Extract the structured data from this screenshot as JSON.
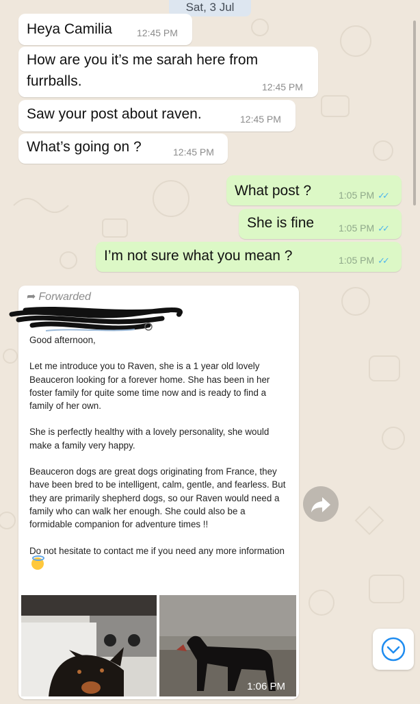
{
  "date_pill": "Sat, 3 Jul",
  "messages": [
    {
      "text": "Heya Camilia",
      "time": "12:45 PM",
      "dir": "in"
    },
    {
      "text": "How are you it’s me sarah here from\nfurrballs.",
      "time": "12:45 PM",
      "dir": "in"
    },
    {
      "text": "Saw your post about raven.",
      "time": "12:45 PM",
      "dir": "in"
    },
    {
      "text": "What’s going on ?",
      "time": "12:45 PM",
      "dir": "in"
    },
    {
      "text": "What post ?",
      "time": "1:05 PM",
      "dir": "out",
      "status": "read"
    },
    {
      "text": "She is fine",
      "time": "1:05 PM",
      "dir": "out",
      "status": "read"
    },
    {
      "text": "I’m not sure what you mean ?",
      "time": "1:05 PM",
      "dir": "out",
      "status": "read"
    }
  ],
  "forwarded": {
    "label": "Forwarded",
    "post_paragraphs": [
      "Good afternoon,",
      "Let me introduce you to Raven, she is a  1 year old lovely Beauceron looking for a forever home. She has been in her foster family for quite some time now and is ready to find a family of her own.",
      "She is perfectly healthy with a lovely personality, she would make a family very happy.",
      "Beauceron dogs are great dogs originating from France, they have been bred to be intelligent, calm, gentle, and fearless. But they are primarily shepherd dogs, so our Raven would need a family who can walk her enough. She could also be a formidable companion for adventure times !!",
      "Do not hesitate to contact me if you need any more information"
    ],
    "time": "1:06 PM"
  },
  "icons": {
    "read_receipt": "double-check-icon",
    "share": "forward-share-icon",
    "scroll_down": "chevron-down-icon"
  },
  "colors": {
    "incoming_bubble": "#ffffff",
    "outgoing_bubble": "#dcf8c6",
    "read_ticks": "#4fb6ec",
    "wallpaper": "#efe7dc",
    "accent": "#1e8cf0"
  }
}
